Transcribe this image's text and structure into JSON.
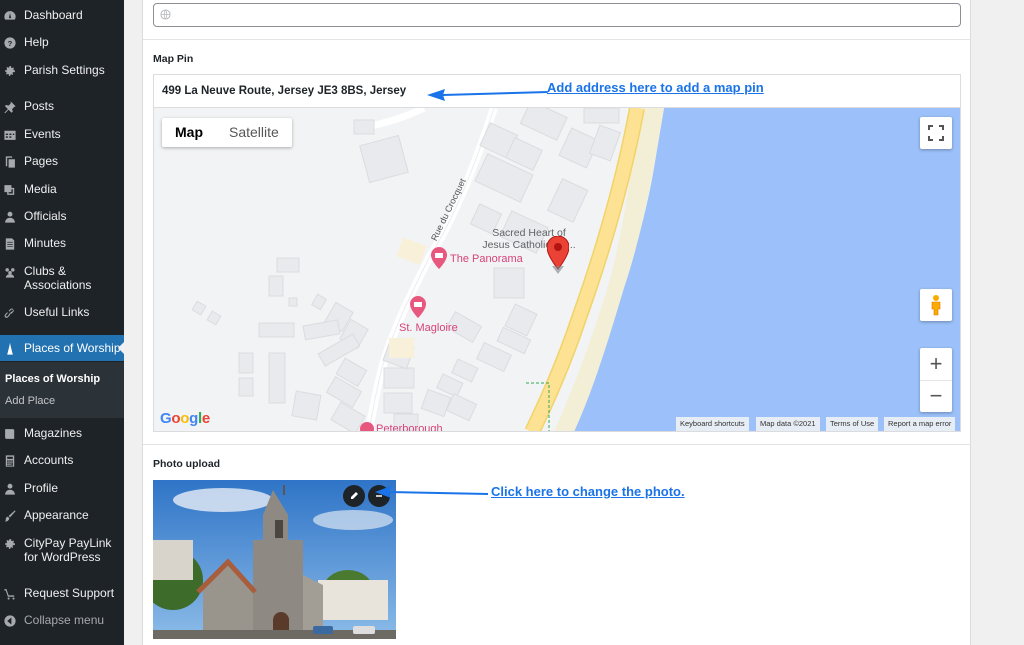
{
  "sidebar": {
    "items": [
      {
        "label": "Dashboard",
        "icon": "dashboard-icon"
      },
      {
        "label": "Help",
        "icon": "help-icon"
      },
      {
        "label": "Parish Settings",
        "icon": "gear-icon"
      },
      {
        "label": "Posts",
        "icon": "pin-icon"
      },
      {
        "label": "Events",
        "icon": "calendar-icon"
      },
      {
        "label": "Pages",
        "icon": "pages-icon"
      },
      {
        "label": "Media",
        "icon": "media-icon"
      },
      {
        "label": "Officials",
        "icon": "person-icon"
      },
      {
        "label": "Minutes",
        "icon": "document-icon"
      },
      {
        "label": "Clubs &",
        "label2": "Associations",
        "icon": "groups-icon"
      },
      {
        "label": "Useful Links",
        "icon": "link-icon"
      },
      {
        "label": "Places of Worship",
        "icon": "worship-icon"
      },
      {
        "label": "Magazines",
        "icon": "book-icon"
      },
      {
        "label": "Accounts",
        "icon": "calculator-icon"
      },
      {
        "label": "Profile",
        "icon": "profile-icon"
      },
      {
        "label": "Appearance",
        "icon": "brush-icon"
      },
      {
        "label": "CityPay PayLink",
        "label2": "for WordPress",
        "icon": "gear-icon"
      },
      {
        "label": "Request Support",
        "icon": "cart-icon"
      }
    ],
    "submenu": {
      "current": "Places of Worship",
      "add": "Add Place"
    },
    "collapse_label": "Collapse menu"
  },
  "map_pin": {
    "label": "Map Pin",
    "address": "499 La Neuve Route, Jersey JE3 8BS, Jersey",
    "callout": "Add address here to add a map pin"
  },
  "map": {
    "type_map": "Map",
    "type_satellite": "Satellite",
    "poi_panorama": "The Panorama",
    "poi_stmagloire": "St. Magloire",
    "poi_peterborough": "Peterborough",
    "poi_church_line1": "Sacred Heart of",
    "poi_church_line2": "Jesus Catholic Ch...",
    "road": "Rue du Crocquet",
    "google": "Google",
    "attribution": {
      "shortcuts": "Keyboard shortcuts",
      "data": "Map data ©2021",
      "terms": "Terms of Use",
      "report": "Report a map error"
    },
    "zoom_in": "+",
    "zoom_out": "−"
  },
  "photo": {
    "label": "Photo upload",
    "callout": "Click here to change the photo."
  },
  "colors": {
    "sidebar_bg": "#1d2327",
    "active": "#2271b1",
    "callout": "#1a73e8",
    "water": "#9cc0f9",
    "road_major": "#fde293"
  }
}
